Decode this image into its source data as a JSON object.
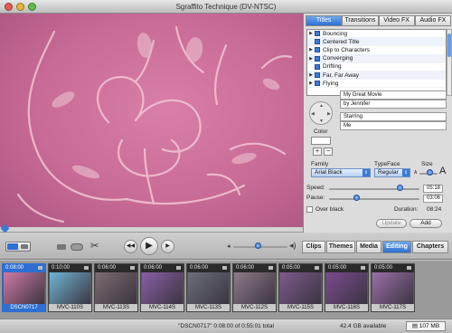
{
  "window": {
    "title": "Sgraffito Technique (DV-NTSC)"
  },
  "panel": {
    "tabs": [
      "Titles",
      "Transitions",
      "Video FX",
      "Audio FX"
    ],
    "active_tab": "Titles",
    "titles_list": [
      "Bouncing",
      "Centered Title",
      "Clip to Characters",
      "Converging",
      "Drifting",
      "Far, Far Away",
      "Flying"
    ],
    "selected_title": "Centered Title",
    "text_fields": [
      "My Great Movie",
      "by Jennifer",
      "Starring",
      "Me"
    ],
    "color_label": "Color",
    "plus": "+",
    "minus": "−",
    "family_label": "Family",
    "family_value": "Arial Black",
    "typeface_label": "TypeFace",
    "typeface_value": "Regular",
    "size_label": "Size",
    "size_small": "A",
    "size_large": "A",
    "speed_label": "Speed:",
    "speed_value": "05:18",
    "speed_level": 0.78,
    "pause_label": "Pause:",
    "pause_value": "03:06",
    "pause_level": 0.3,
    "over_black_label": "Over black",
    "duration_label": "Duration:",
    "duration_value": "08:24",
    "update_label": "Update",
    "add_label": "Add"
  },
  "controls": {
    "pane_tabs": [
      "Clips",
      "Themes",
      "Media",
      "Editing",
      "Chapters"
    ],
    "active_pane": "Editing",
    "volume_level": 0.45
  },
  "clips": [
    {
      "tc": "0:08:00",
      "name": "DSCN0717",
      "selected": true,
      "color": "#d079a5"
    },
    {
      "tc": "0:10:00",
      "name": "MVC-110S",
      "selected": false,
      "color": "#6fb6d3"
    },
    {
      "tc": "0:06:00",
      "name": "MVC-113S",
      "selected": false,
      "color": "#7b6a72"
    },
    {
      "tc": "0:06:00",
      "name": "MVC-114S",
      "selected": false,
      "color": "#8a5fa6"
    },
    {
      "tc": "0:06:00",
      "name": "MVC-113S",
      "selected": false,
      "color": "#6a6f7a"
    },
    {
      "tc": "0:06:00",
      "name": "MVC-112S",
      "selected": false,
      "color": "#8f7a88"
    },
    {
      "tc": "0:05:00",
      "name": "MVC-115S",
      "selected": false,
      "color": "#7e5a8c"
    },
    {
      "tc": "0:05:00",
      "name": "MVC-116S",
      "selected": false,
      "color": "#7a4a8e"
    },
    {
      "tc": "0:05:00",
      "name": "MVC-117S",
      "selected": false,
      "color": "#9c6fa8"
    }
  ],
  "status": {
    "text": "\"DSCN0717\"  0:08:00 of 0:55:01 total",
    "free": "42.4 GB available",
    "size": "107 MB"
  }
}
